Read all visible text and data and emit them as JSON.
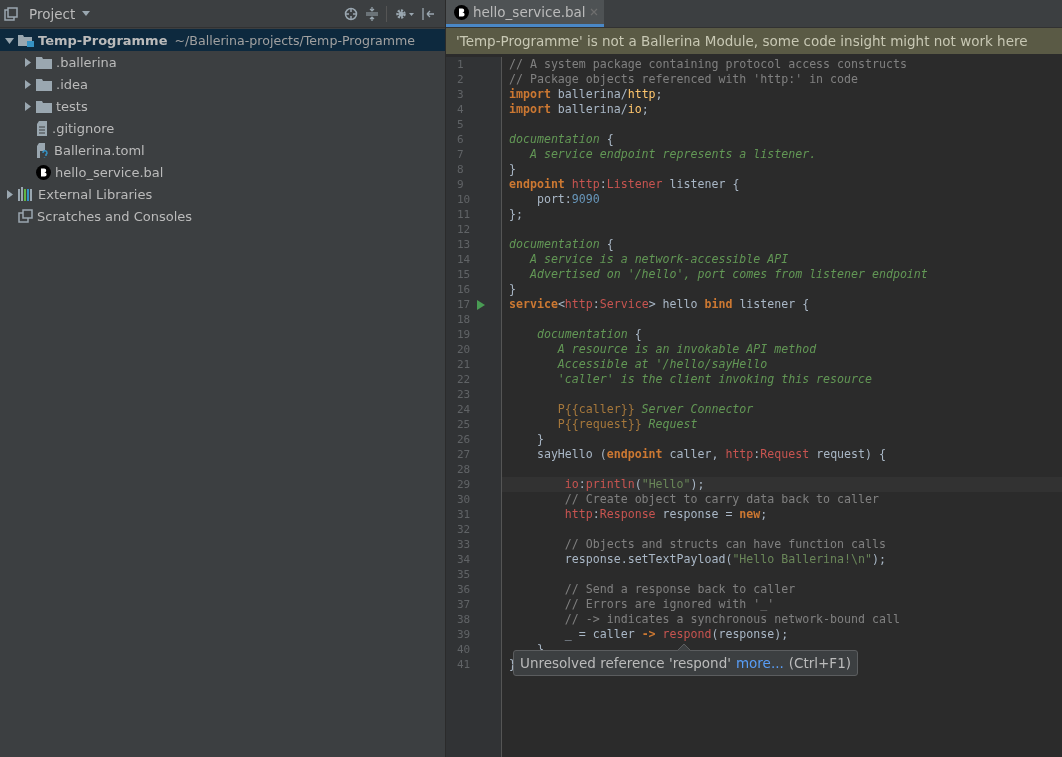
{
  "project_panel": {
    "title": "Project",
    "tree": [
      {
        "label": "Temp-Programme",
        "path": "~/Ballerina-projects/Temp-Programme",
        "kind": "module",
        "expanded": true,
        "selected": true,
        "children": [
          {
            "label": ".ballerina",
            "kind": "folder",
            "expanded": false,
            "selected": false
          },
          {
            "label": ".idea",
            "kind": "folder",
            "expanded": false,
            "selected": false
          },
          {
            "label": "tests",
            "kind": "folder",
            "expanded": false,
            "selected": false
          },
          {
            "label": ".gitignore",
            "kind": "file",
            "selected": false
          },
          {
            "label": "Ballerina.toml",
            "kind": "unknown",
            "selected": false
          },
          {
            "label": "hello_service.bal",
            "kind": "bal",
            "selected": false
          }
        ]
      },
      {
        "label": "External Libraries",
        "kind": "library",
        "expanded": false,
        "selected": false
      },
      {
        "label": "Scratches and Consoles",
        "kind": "scratch",
        "selected": false
      }
    ]
  },
  "editor": {
    "tabs": [
      {
        "label": "hello_service.bal",
        "selected": true
      }
    ],
    "banner": "'Temp-Programme' is not a Ballerina Module, some code insight might not work here",
    "lines": [
      {
        "number": "1",
        "tokens": [
          {
            "kind": "comment",
            "text": "// A system package containing protocol access constructs"
          }
        ]
      },
      {
        "number": "2",
        "tokens": [
          {
            "kind": "comment",
            "text": "// Package objects referenced with 'http:' in code"
          }
        ]
      },
      {
        "number": "3",
        "tokens": [
          {
            "kind": "keyword",
            "text": "import"
          },
          {
            "kind": "plain",
            "text": " ballerina/"
          },
          {
            "kind": "package",
            "text": "http"
          },
          {
            "kind": "plain",
            "text": ";"
          }
        ]
      },
      {
        "number": "4",
        "tokens": [
          {
            "kind": "keyword",
            "text": "import"
          },
          {
            "kind": "plain",
            "text": " ballerina/"
          },
          {
            "kind": "package",
            "text": "io"
          },
          {
            "kind": "plain",
            "text": ";"
          }
        ]
      },
      {
        "number": "5"
      },
      {
        "number": "6",
        "tokens": [
          {
            "kind": "doc",
            "text": "documentation"
          },
          {
            "kind": "plain",
            "text": " {"
          }
        ]
      },
      {
        "number": "7",
        "tokens": [
          {
            "kind": "doc",
            "text": "   A service endpoint represents a listener."
          }
        ]
      },
      {
        "number": "8",
        "tokens": [
          {
            "kind": "plain",
            "text": "}"
          }
        ]
      },
      {
        "number": "9",
        "tokens": [
          {
            "kind": "keyword",
            "text": "endpoint "
          },
          {
            "kind": "type",
            "text": "http"
          },
          {
            "kind": "plain",
            "text": ":"
          },
          {
            "kind": "type",
            "text": "Listener"
          },
          {
            "kind": "plain",
            "text": " listener {"
          }
        ]
      },
      {
        "number": "10",
        "tokens": [
          {
            "kind": "plain",
            "text": "    port:"
          },
          {
            "kind": "number",
            "text": "9090"
          }
        ]
      },
      {
        "number": "11",
        "tokens": [
          {
            "kind": "plain",
            "text": "};"
          }
        ]
      },
      {
        "number": "12"
      },
      {
        "number": "13",
        "tokens": [
          {
            "kind": "doc",
            "text": "documentation"
          },
          {
            "kind": "plain",
            "text": " {"
          }
        ]
      },
      {
        "number": "14",
        "tokens": [
          {
            "kind": "doc",
            "text": "   A service is a network-accessible API"
          }
        ]
      },
      {
        "number": "15",
        "tokens": [
          {
            "kind": "doc",
            "text": "   Advertised on '/hello', port comes from listener endpoint"
          }
        ]
      },
      {
        "number": "16",
        "tokens": [
          {
            "kind": "plain",
            "text": "}"
          }
        ]
      },
      {
        "number": "17",
        "run": true,
        "tokens": [
          {
            "kind": "keyword",
            "text": "service"
          },
          {
            "kind": "plain",
            "text": "<"
          },
          {
            "kind": "type",
            "text": "http"
          },
          {
            "kind": "plain",
            "text": ":"
          },
          {
            "kind": "type",
            "text": "Service"
          },
          {
            "kind": "plain",
            "text": "> hello "
          },
          {
            "kind": "keyword",
            "text": "bind"
          },
          {
            "kind": "plain",
            "text": " listener {"
          }
        ]
      },
      {
        "number": "18"
      },
      {
        "number": "19",
        "tokens": [
          {
            "kind": "doc",
            "text": "    documentation"
          },
          {
            "kind": "plain",
            "text": " {"
          }
        ]
      },
      {
        "number": "20",
        "tokens": [
          {
            "kind": "doc",
            "text": "       A resource is an invokable API method"
          }
        ]
      },
      {
        "number": "21",
        "tokens": [
          {
            "kind": "doc",
            "text": "       Accessible at '/hello/sayHello"
          }
        ]
      },
      {
        "number": "22",
        "tokens": [
          {
            "kind": "doc",
            "text": "       'caller' is the client invoking this resource"
          }
        ]
      },
      {
        "number": "23"
      },
      {
        "number": "24",
        "tokens": [
          {
            "kind": "param",
            "text": "       P{{caller}}"
          },
          {
            "kind": "doc",
            "text": " Server Connector"
          }
        ]
      },
      {
        "number": "25",
        "tokens": [
          {
            "kind": "param",
            "text": "       P{{request}}"
          },
          {
            "kind": "doc",
            "text": " Request"
          }
        ]
      },
      {
        "number": "26",
        "tokens": [
          {
            "kind": "plain",
            "text": "    }"
          }
        ]
      },
      {
        "number": "27",
        "tokens": [
          {
            "kind": "plain",
            "text": "    sayHello ("
          },
          {
            "kind": "keyword",
            "text": "endpoint"
          },
          {
            "kind": "plain",
            "text": " caller, "
          },
          {
            "kind": "type",
            "text": "http"
          },
          {
            "kind": "plain",
            "text": ":"
          },
          {
            "kind": "type",
            "text": "Request"
          },
          {
            "kind": "plain",
            "text": " request) {"
          }
        ]
      },
      {
        "number": "28"
      },
      {
        "number": "29",
        "current": true,
        "tokens": [
          {
            "kind": "type",
            "text": "        io"
          },
          {
            "kind": "plain",
            "text": ":"
          },
          {
            "kind": "type",
            "text": "println"
          },
          {
            "kind": "plain",
            "text": "("
          },
          {
            "kind": "string",
            "text": "\"Hello\""
          },
          {
            "kind": "plain",
            "text": ");"
          }
        ]
      },
      {
        "number": "30",
        "tokens": [
          {
            "kind": "comment",
            "text": "        // Create object to carry data back to caller"
          }
        ]
      },
      {
        "number": "31",
        "tokens": [
          {
            "kind": "type",
            "text": "        http"
          },
          {
            "kind": "plain",
            "text": ":"
          },
          {
            "kind": "type",
            "text": "Response"
          },
          {
            "kind": "plain",
            "text": " response = "
          },
          {
            "kind": "keyword",
            "text": "new"
          },
          {
            "kind": "plain",
            "text": ";"
          }
        ]
      },
      {
        "number": "32"
      },
      {
        "number": "33",
        "tokens": [
          {
            "kind": "comment",
            "text": "        // Objects and structs can have function calls"
          }
        ]
      },
      {
        "number": "34",
        "tokens": [
          {
            "kind": "plain",
            "text": "        response.setTextPayload("
          },
          {
            "kind": "string",
            "text": "\"Hello Ballerina!\\n\""
          },
          {
            "kind": "plain",
            "text": ");"
          }
        ]
      },
      {
        "number": "35"
      },
      {
        "number": "36",
        "tokens": [
          {
            "kind": "comment",
            "text": "        // Send a response back to caller"
          }
        ]
      },
      {
        "number": "37",
        "tokens": [
          {
            "kind": "comment",
            "text": "        // Errors are ignored with '_'"
          }
        ]
      },
      {
        "number": "38",
        "tokens": [
          {
            "kind": "comment",
            "text": "        // -> indicates a synchronous network-bound call"
          }
        ]
      },
      {
        "number": "39",
        "tokens": [
          {
            "kind": "plain",
            "text": "        _ = caller "
          },
          {
            "kind": "keyword",
            "text": "-> "
          },
          {
            "kind": "type",
            "text": "respond"
          },
          {
            "kind": "plain",
            "text": "(response);"
          }
        ]
      },
      {
        "number": "40",
        "tokens": [
          {
            "kind": "plain",
            "text": "    }"
          }
        ]
      },
      {
        "number": "41",
        "tokens": [
          {
            "kind": "plain",
            "text": "}"
          }
        ]
      }
    ],
    "tooltip": {
      "message": "Unresolved reference 'respond'",
      "link": "more...",
      "shortcut": "(Ctrl+F1)"
    }
  }
}
